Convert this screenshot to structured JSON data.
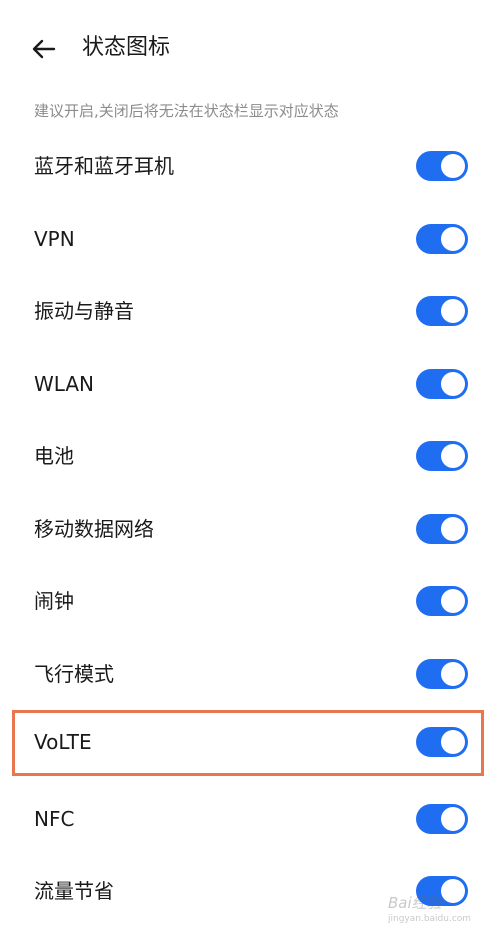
{
  "header": {
    "back_icon": "arrow-left-icon",
    "title": "状态图标"
  },
  "hint": "建议开启,关闭后将无法在状态栏显示对应状态",
  "toggles": [
    {
      "label": "蓝牙和蓝牙耳机",
      "on": true
    },
    {
      "label": "VPN",
      "on": true
    },
    {
      "label": "振动与静音",
      "on": true
    },
    {
      "label": "WLAN",
      "on": true
    },
    {
      "label": "电池",
      "on": true
    },
    {
      "label": "移动数据网络",
      "on": true
    },
    {
      "label": "闹钟",
      "on": true
    },
    {
      "label": "飞行模式",
      "on": true
    },
    {
      "label": "VoLTE",
      "on": true,
      "highlighted": true
    },
    {
      "label": "NFC",
      "on": true
    },
    {
      "label": "流量节省",
      "on": true
    }
  ],
  "colors": {
    "switch_on": "#1f6ef2",
    "highlight": "#e8764e",
    "hint_text": "#8c8c8c"
  },
  "watermark": {
    "text": "Bai经验",
    "sub": "jingyan.baidu.com"
  }
}
